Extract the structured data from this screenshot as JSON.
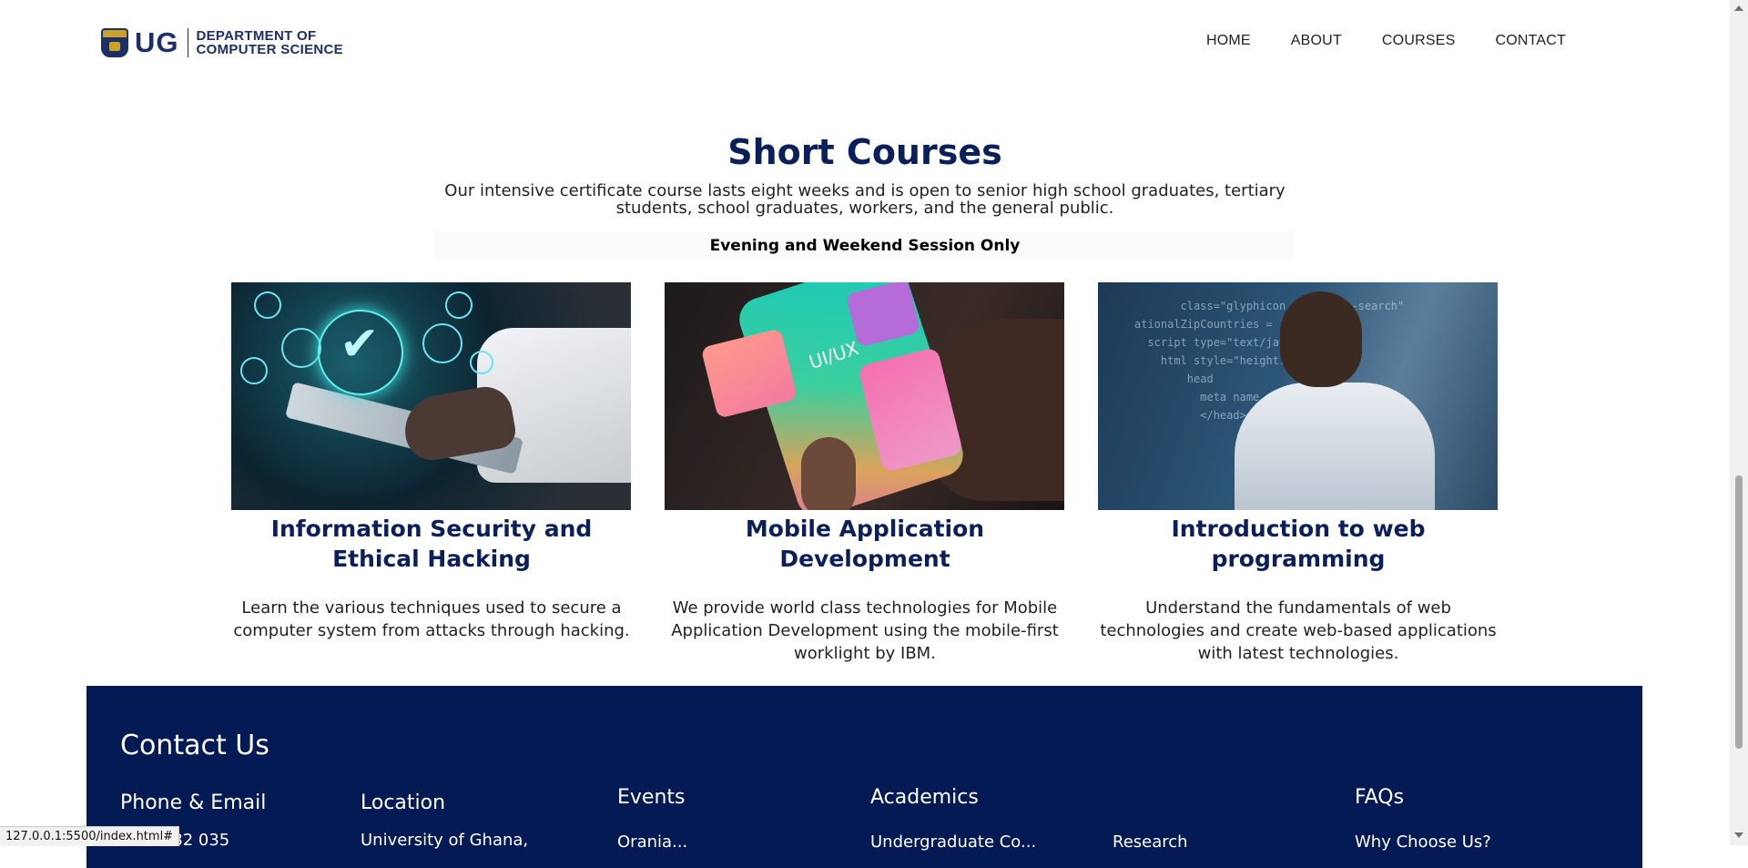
{
  "header": {
    "logo_abbr": "UG",
    "logo_line1": "DEPARTMENT OF",
    "logo_line2": "COMPUTER SCIENCE",
    "nav": [
      {
        "label": "HOME"
      },
      {
        "label": "ABOUT"
      },
      {
        "label": "COURSES"
      },
      {
        "label": "CONTACT"
      }
    ]
  },
  "intro": {
    "title": "Short Courses",
    "description": "Our intensive certificate course lasts eight weeks and is open to senior high school graduates, tertiary students, school graduates, workers, and the general public.",
    "session": "Evening and Weekend Session Only"
  },
  "courses": [
    {
      "title": "Information Security and Ethical Hacking",
      "description": "Learn the various techniques used to secure a computer system from attacks through hacking.",
      "image_icon": "security-shield-image"
    },
    {
      "title": "Mobile Application Development",
      "description": "We provide world class technologies for Mobile Application Development using the mobile-first worklight by IBM.",
      "image_icon": "mobile-ui-ux-image",
      "image_text": "UI/UX"
    },
    {
      "title": "Introduction to web programming",
      "description": "Understand the fundamentals of web technologies and create web-based applications with latest technologies.",
      "image_icon": "web-programmer-image"
    }
  ],
  "footer": {
    "heading": "Contact Us",
    "columns": [
      {
        "title": "Phone & Email",
        "text": "...01 382 035"
      },
      {
        "title": "Location",
        "text": "University of Ghana,"
      },
      {
        "title": "Events",
        "text": "Orania..."
      },
      {
        "title": "Academics",
        "text": "Undergraduate Co..."
      },
      {
        "title": "",
        "text": "Research"
      },
      {
        "title": "FAQs",
        "text": "Why Choose Us?"
      }
    ]
  },
  "status_bar": {
    "url": "127.0.0.1:5500/index.html#"
  },
  "colors": {
    "brand_navy": "#0b1f5a",
    "footer_bg": "#041a54"
  }
}
